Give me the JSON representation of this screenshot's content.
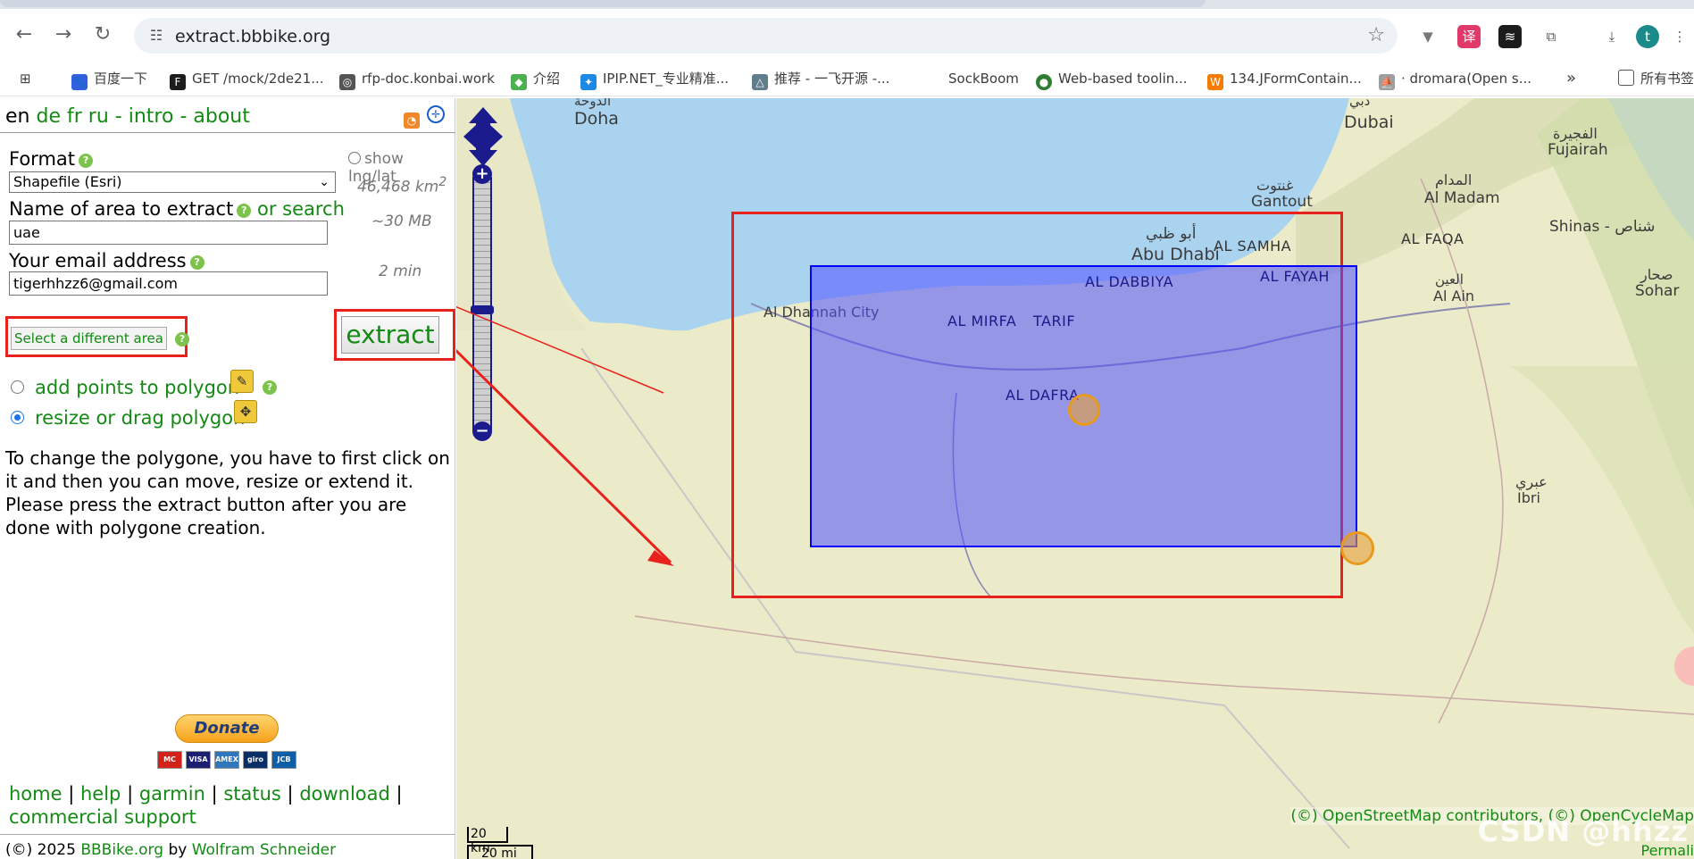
{
  "browser": {
    "url": "extract.bbbike.org",
    "bookmarks": [
      {
        "label": "百度一下",
        "color": "#3060e0"
      },
      {
        "label": "GET /mock/2de21...",
        "color": "#1d1d1d"
      },
      {
        "label": "rfp-doc.konbai.work",
        "color": "#555555"
      },
      {
        "label": "介绍",
        "color": "#4caf50"
      },
      {
        "label": "IPIP.NET_专业精准...",
        "color": "#1e88e5"
      },
      {
        "label": "推荐 - 一飞开源 -...",
        "color": "#607d8b"
      },
      {
        "label": "SockBoom",
        "color": "#ffffff"
      },
      {
        "label": "Web-based toolin...",
        "color": "#2e7d32"
      },
      {
        "label": "134.JFormContain...",
        "color": "#f57c00"
      },
      {
        "label": "· dromara(Open s...",
        "color": "#9e9e9e"
      }
    ],
    "more_bookmarks": "»",
    "all_bookmarks": "所有书签",
    "profile_initial": "t"
  },
  "panel": {
    "lang_current": "en",
    "lang_links": [
      "de",
      "fr",
      "ru"
    ],
    "intro": "intro",
    "about": "about",
    "format_label": "Format",
    "format_value": "Shapefile (Esri)",
    "show_lnglat": "show lng/lat",
    "area_stat": "46,468 km",
    "area_sup": "2",
    "name_label": "Name of area to extract",
    "or_search": "or search",
    "name_value": "uae",
    "size_stat": "~30 MB",
    "email_label": "Your email address",
    "email_value": "tigerhhzz6@gmail.com",
    "time_stat": "2 min",
    "select_different": "Select a different area",
    "extract": "extract",
    "add_points": "add points to polygon",
    "resize_drag": "resize or drag polygon",
    "description": "To change the polygone, you have to first click on it and then you can move, resize or extend it. Please press the extract button after you are done with polygone creation.",
    "donate": "Donate",
    "cards": [
      "MC",
      "VISA",
      "AMEX",
      "giro",
      "JCB"
    ],
    "footer_links": [
      "home",
      "help",
      "garmin",
      "status",
      "download",
      "commercial support"
    ],
    "copyright_prefix": "(©) 2025",
    "bbbike": "BBBike.org",
    "by": "by",
    "author": "Wolfram Schneider"
  },
  "map": {
    "cities": [
      {
        "name": "Doha"
      },
      {
        "name": "الدوحة"
      },
      {
        "name": "Dubai"
      },
      {
        "name": "دبي"
      },
      {
        "name": "Fujairah"
      },
      {
        "name": "الفجيرة"
      },
      {
        "name": "Al Madam"
      },
      {
        "name": "المدام"
      },
      {
        "name": "Gantout"
      },
      {
        "name": "غنتوت"
      },
      {
        "name": "AL FAQA"
      },
      {
        "name": "Shinas - شناص"
      },
      {
        "name": "AL SAMHA"
      },
      {
        "name": "Abu Dhabi"
      },
      {
        "name": "أبو ظبي"
      },
      {
        "name": "Sohar"
      },
      {
        "name": "صحار"
      },
      {
        "name": "Al Ain"
      },
      {
        "name": "العين"
      },
      {
        "name": "Ibri"
      },
      {
        "name": "عبري"
      },
      {
        "name": "Al Dhannah City"
      }
    ],
    "regions": [
      "AL DABBIYA",
      "AL FAYAH",
      "AL MIRFA",
      "TARIF",
      "AL DAFRA"
    ],
    "attribution": "(©) OpenStreetMap contributors, (©) OpenCycleMap",
    "scale_km": "20 km",
    "scale_mi": "20 mi",
    "watermark": "CSDN @hhzz",
    "permalink": "Permali",
    "polygon_color": "#0000ff",
    "annotation_color": "#e8211c"
  }
}
